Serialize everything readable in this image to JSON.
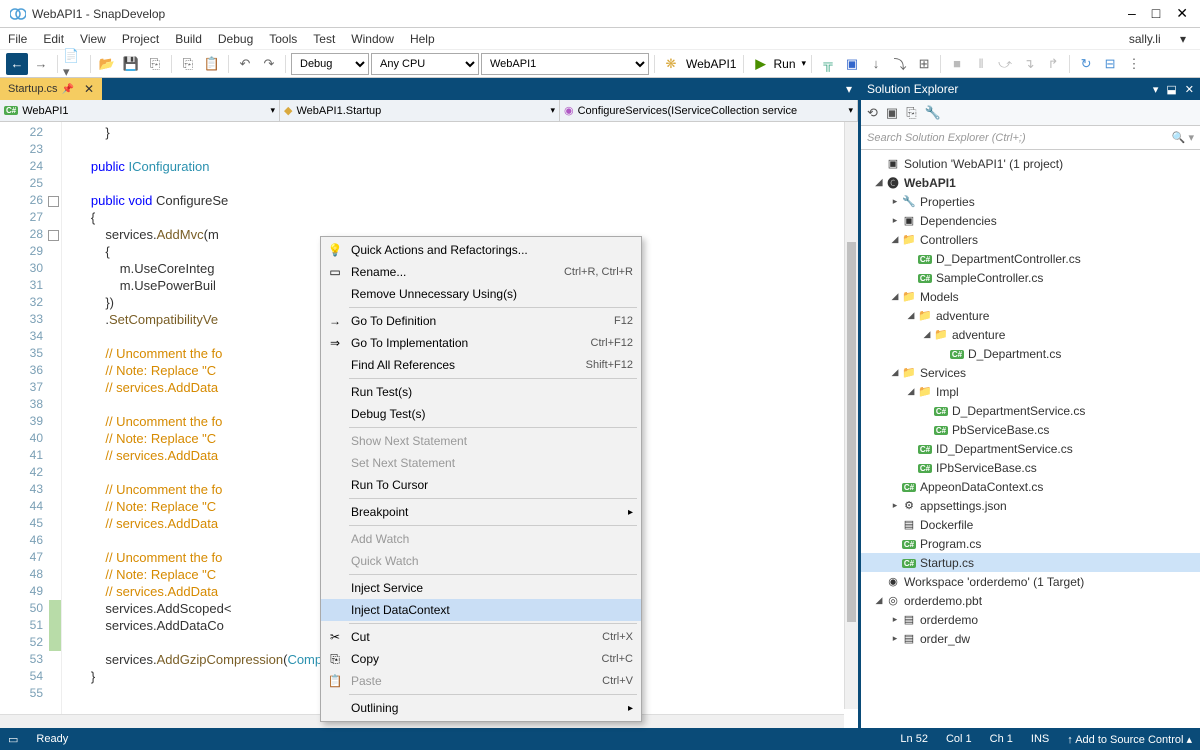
{
  "title": "WebAPI1 - SnapDevelop",
  "menu": [
    "File",
    "Edit",
    "View",
    "Project",
    "Build",
    "Debug",
    "Tools",
    "Test",
    "Window",
    "Help"
  ],
  "user": "sally.li",
  "combos": {
    "config": "Debug",
    "platform": "Any CPU",
    "project": "WebAPI1",
    "startup": "WebAPI1",
    "run": "Run"
  },
  "tab": {
    "name": "Startup.cs"
  },
  "dropdowns": {
    "d1": "WebAPI1",
    "d2": "WebAPI1.Startup",
    "d3": "ConfigureServices(IServiceCollection service"
  },
  "lines": [
    {
      "n": 22,
      "t": "            }"
    },
    {
      "n": 23,
      "t": ""
    },
    {
      "n": 24,
      "t": "        <kw>public</kw> <type>IConfiguration</type> "
    },
    {
      "n": 25,
      "t": ""
    },
    {
      "n": 26,
      "t": "        <kw>public</kw> <kw>void</kw> ConfigureSe",
      "mark": true
    },
    {
      "n": 27,
      "t": "        {"
    },
    {
      "n": 28,
      "t": "            services.<mth>AddMvc</mth>(m ",
      "mark": true
    },
    {
      "n": 29,
      "t": "            {"
    },
    {
      "n": 30,
      "t": "                m.UseCoreInteg"
    },
    {
      "n": 31,
      "t": "                m.UsePowerBuil"
    },
    {
      "n": 32,
      "t": "            })"
    },
    {
      "n": 33,
      "t": "            .<mth>SetCompatibilityVe</mth>"
    },
    {
      "n": 34,
      "t": ""
    },
    {
      "n": 35,
      "t": "            <com>// Uncomment the fo</com>                             <com>database.</com>"
    },
    {
      "n": 36,
      "t": "            <com>// Note: Replace \"C</com>                             <com>ame; replace \"key\" with t</com>"
    },
    {
      "n": 37,
      "t": "            <com>// services.AddData</com>                             <com>Configuration[</com><str>\"Connectio</str>"
    },
    {
      "n": 38,
      "t": ""
    },
    {
      "n": 39,
      "t": "            <com>// Uncomment the fo</com>                             <com>abase.</com>"
    },
    {
      "n": 40,
      "t": "            <com>// Note: Replace \"C</com>                             <com>ame; replace \"key\" with t</com>"
    },
    {
      "n": 41,
      "t": "            <com>// services.AddData</com>                             <com>figuration[</com><str>\"ConnectionStr</str>"
    },
    {
      "n": 42,
      "t": ""
    },
    {
      "n": 43,
      "t": "            <com>// Uncomment the fo</com>                             <com>database.</com>"
    },
    {
      "n": 44,
      "t": "            <com>// Note: Replace \"C</com>                             <com>ame; replace \"key\" with t</com>"
    },
    {
      "n": 45,
      "t": "            <com>// services.AddData</com>                             <com>Configuration[</com><str>\"Connectic</str>"
    },
    {
      "n": 46,
      "t": ""
    },
    {
      "n": 47,
      "t": "            <com>// Uncomment the fo</com>                             <com>ase.</com>"
    },
    {
      "n": 48,
      "t": "            <com>// Note: Replace \"C</com>                             <com>ame; replace \"key\" with t</com>"
    },
    {
      "n": 49,
      "t": "            <com>// services.AddData</com>                             <com>guration[</com><str>\"ConnectionStrin</str>"
    },
    {
      "n": 50,
      "t": "            services.AddScoped<",
      "bar": true
    },
    {
      "n": 51,
      "t": "            services.AddDataCo                              er(Configuration[<str>\"Connect</str>",
      "bar": true
    },
    {
      "n": 52,
      "t": "",
      "bar": true
    },
    {
      "n": 53,
      "t": "            services.<mth>AddGzipCompression</mth>(<type>CompressionLevel</type>.Fastest);"
    },
    {
      "n": 54,
      "t": "        }"
    },
    {
      "n": 55,
      "t": ""
    }
  ],
  "contextMenu": [
    {
      "label": "Quick Actions and Refactorings...",
      "icon": "💡"
    },
    {
      "label": "Rename...",
      "shortcut": "Ctrl+R, Ctrl+R",
      "icon": "▭"
    },
    {
      "label": "Remove Unnecessary Using(s)"
    },
    {
      "sep": true
    },
    {
      "label": "Go To Definition",
      "shortcut": "F12",
      "icon": "→"
    },
    {
      "label": "Go To Implementation",
      "shortcut": "Ctrl+F12",
      "icon": "⇒"
    },
    {
      "label": "Find All References",
      "shortcut": "Shift+F12"
    },
    {
      "sep": true
    },
    {
      "label": "Run Test(s)"
    },
    {
      "label": "Debug Test(s)"
    },
    {
      "sep": true
    },
    {
      "label": "Show Next Statement",
      "dis": true
    },
    {
      "label": "Set Next Statement",
      "dis": true
    },
    {
      "label": "Run To Cursor"
    },
    {
      "sep": true
    },
    {
      "label": "Breakpoint",
      "sub": true
    },
    {
      "sep": true
    },
    {
      "label": "Add Watch",
      "dis": true
    },
    {
      "label": "Quick Watch",
      "dis": true
    },
    {
      "sep": true
    },
    {
      "label": "Inject Service"
    },
    {
      "label": "Inject DataContext",
      "hl": true
    },
    {
      "sep": true
    },
    {
      "label": "Cut",
      "shortcut": "Ctrl+X",
      "icon": "✂"
    },
    {
      "label": "Copy",
      "shortcut": "Ctrl+C",
      "icon": "⎘"
    },
    {
      "label": "Paste",
      "shortcut": "Ctrl+V",
      "icon": "📋",
      "dis": true
    },
    {
      "sep": true
    },
    {
      "label": "Outlining",
      "sub": true
    }
  ],
  "solutionExplorer": {
    "title": "Solution Explorer",
    "searchPlaceholder": "Search Solution Explorer (Ctrl+;)",
    "tree": [
      {
        "ind": 0,
        "exp": "",
        "ic": "▣",
        "label": "Solution 'WebAPI1' (1 project)"
      },
      {
        "ind": 0,
        "exp": "◢",
        "ic": "🅒",
        "label": "WebAPI1",
        "bold": true
      },
      {
        "ind": 1,
        "exp": "▸",
        "ic": "🔧",
        "label": "Properties"
      },
      {
        "ind": 1,
        "exp": "▸",
        "ic": "▣",
        "label": "Dependencies"
      },
      {
        "ind": 1,
        "exp": "◢",
        "ic": "📁",
        "label": "Controllers",
        "fold": true
      },
      {
        "ind": 2,
        "exp": "",
        "ic": "C#",
        "label": "D_DepartmentController.cs",
        "cs": true
      },
      {
        "ind": 2,
        "exp": "",
        "ic": "C#",
        "label": "SampleController.cs",
        "cs": true
      },
      {
        "ind": 1,
        "exp": "◢",
        "ic": "📁",
        "label": "Models",
        "fold": true
      },
      {
        "ind": 2,
        "exp": "◢",
        "ic": "📁",
        "label": "adventure",
        "fold": true
      },
      {
        "ind": 3,
        "exp": "◢",
        "ic": "📁",
        "label": "adventure",
        "fold": true
      },
      {
        "ind": 4,
        "exp": "",
        "ic": "C#",
        "label": "D_Department.cs",
        "cs": true
      },
      {
        "ind": 1,
        "exp": "◢",
        "ic": "📁",
        "label": "Services",
        "fold": true
      },
      {
        "ind": 2,
        "exp": "◢",
        "ic": "📁",
        "label": "Impl",
        "fold": true
      },
      {
        "ind": 3,
        "exp": "",
        "ic": "C#",
        "label": "D_DepartmentService.cs",
        "cs": true
      },
      {
        "ind": 3,
        "exp": "",
        "ic": "C#",
        "label": "PbServiceBase.cs",
        "cs": true
      },
      {
        "ind": 2,
        "exp": "",
        "ic": "C#",
        "label": "ID_DepartmentService.cs",
        "cs": true
      },
      {
        "ind": 2,
        "exp": "",
        "ic": "C#",
        "label": "IPbServiceBase.cs",
        "cs": true
      },
      {
        "ind": 1,
        "exp": "",
        "ic": "C#",
        "label": "AppeonDataContext.cs",
        "cs": true
      },
      {
        "ind": 1,
        "exp": "▸",
        "ic": "⚙",
        "label": "appsettings.json"
      },
      {
        "ind": 1,
        "exp": "",
        "ic": "▤",
        "label": "Dockerfile"
      },
      {
        "ind": 1,
        "exp": "",
        "ic": "C#",
        "label": "Program.cs",
        "cs": true
      },
      {
        "ind": 1,
        "exp": "",
        "ic": "C#",
        "label": "Startup.cs",
        "cs": true,
        "sel": true
      },
      {
        "ind": 0,
        "exp": "",
        "ic": "◉",
        "label": "Workspace 'orderdemo' (1 Target)"
      },
      {
        "ind": 0,
        "exp": "◢",
        "ic": "◎",
        "label": "orderdemo.pbt"
      },
      {
        "ind": 1,
        "exp": "▸",
        "ic": "▤",
        "label": "orderdemo"
      },
      {
        "ind": 1,
        "exp": "▸",
        "ic": "▤",
        "label": "order_dw"
      }
    ]
  },
  "status": {
    "ready": "Ready",
    "ln": "Ln 52",
    "col": "Col 1",
    "ch": "Ch 1",
    "ins": "INS",
    "source": "Add to Source Control"
  }
}
